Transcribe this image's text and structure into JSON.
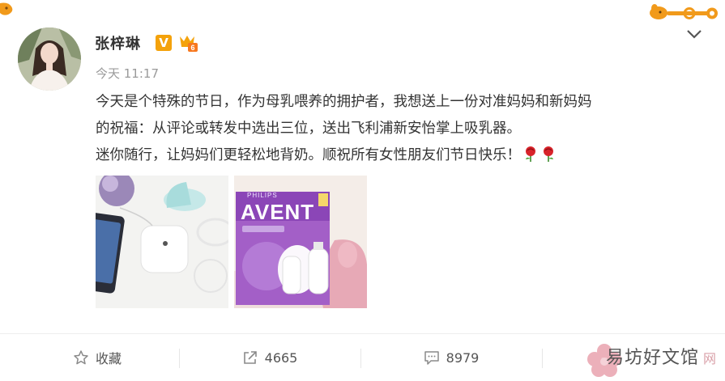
{
  "post": {
    "username": "张梓琳",
    "verified_badge": "V",
    "timestamp": "今天 11:17",
    "text_lines": [
      "今天是个特殊的节日，作为母乳喂养的拥护者，我想送上一份对准妈妈和新妈妈",
      "的祝福：从评论或转发中选出三位，送出飞利浦新安怡掌上吸乳器。",
      "迷你随行，让妈妈们更轻松地背奶。顺祝所有女性朋友们节日快乐！"
    ],
    "emoji": [
      "rose-icon",
      "rose-icon"
    ],
    "images": [
      {
        "name": "breast-pump-product-photo"
      },
      {
        "name": "philips-avent-box-photo",
        "brand_small": "PHILIPS",
        "brand": "AVENT"
      }
    ]
  },
  "actions": {
    "favorite_label": "收藏",
    "share_count": "4665",
    "comment_count": "8979"
  },
  "watermark": {
    "text": "易坊好文馆",
    "suffix": "网"
  },
  "colors": {
    "verified": "#f4a20b",
    "text": "#333333",
    "meta": "#9a9a9a",
    "deco": "#f19a1b"
  }
}
